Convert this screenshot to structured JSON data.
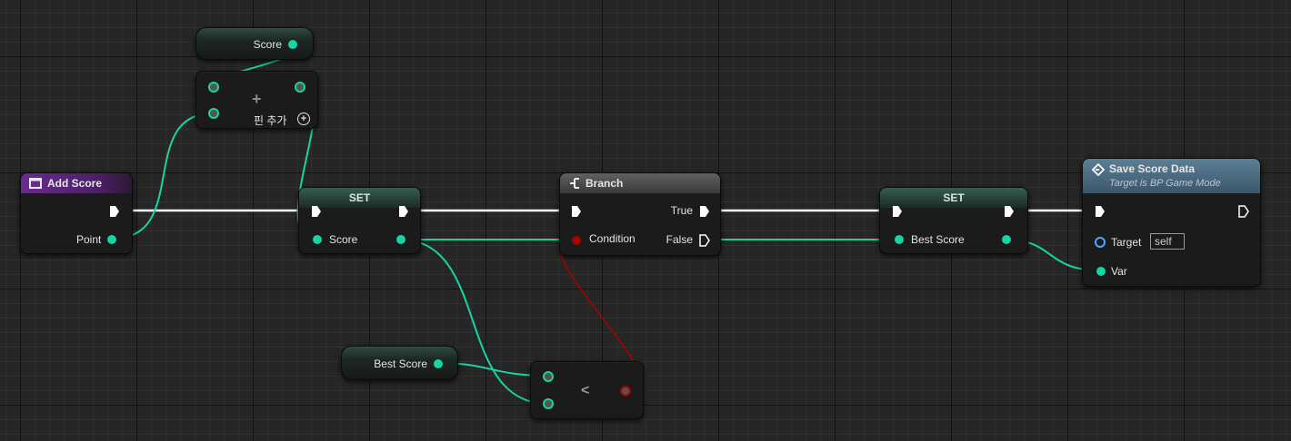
{
  "colors": {
    "exec_wire": "#ffffff",
    "float_wire": "#17d5a3",
    "bool_wire": "#a90000",
    "event_header": "#6a2a8e",
    "function_header": "#5c7f96",
    "set_header": "#335f52"
  },
  "nodes": {
    "score_getter": {
      "var": "Score"
    },
    "add_node": {
      "op_icon": "plus-icon",
      "add_pin_label": "핀 추가",
      "add_pin_icon": "add-circle-icon"
    },
    "add_score_event": {
      "title": "Add Score",
      "icon": "event-icon",
      "pin_point": "Point"
    },
    "set_score": {
      "title": "SET",
      "pin_score": "Score"
    },
    "branch": {
      "title": "Branch",
      "icon": "branch-icon",
      "pin_condition": "Condition",
      "pin_true": "True",
      "pin_false": "False"
    },
    "set_best_score": {
      "title": "SET",
      "pin_best_score": "Best Score"
    },
    "save_score_data": {
      "title": "Save Score Data",
      "subtitle": "Target is BP Game Mode",
      "icon": "function-icon",
      "pin_target": "Target",
      "target_value": "self",
      "pin_var": "Var"
    },
    "best_score_getter": {
      "var": "Best Score"
    },
    "less_than": {
      "op": "<"
    }
  }
}
